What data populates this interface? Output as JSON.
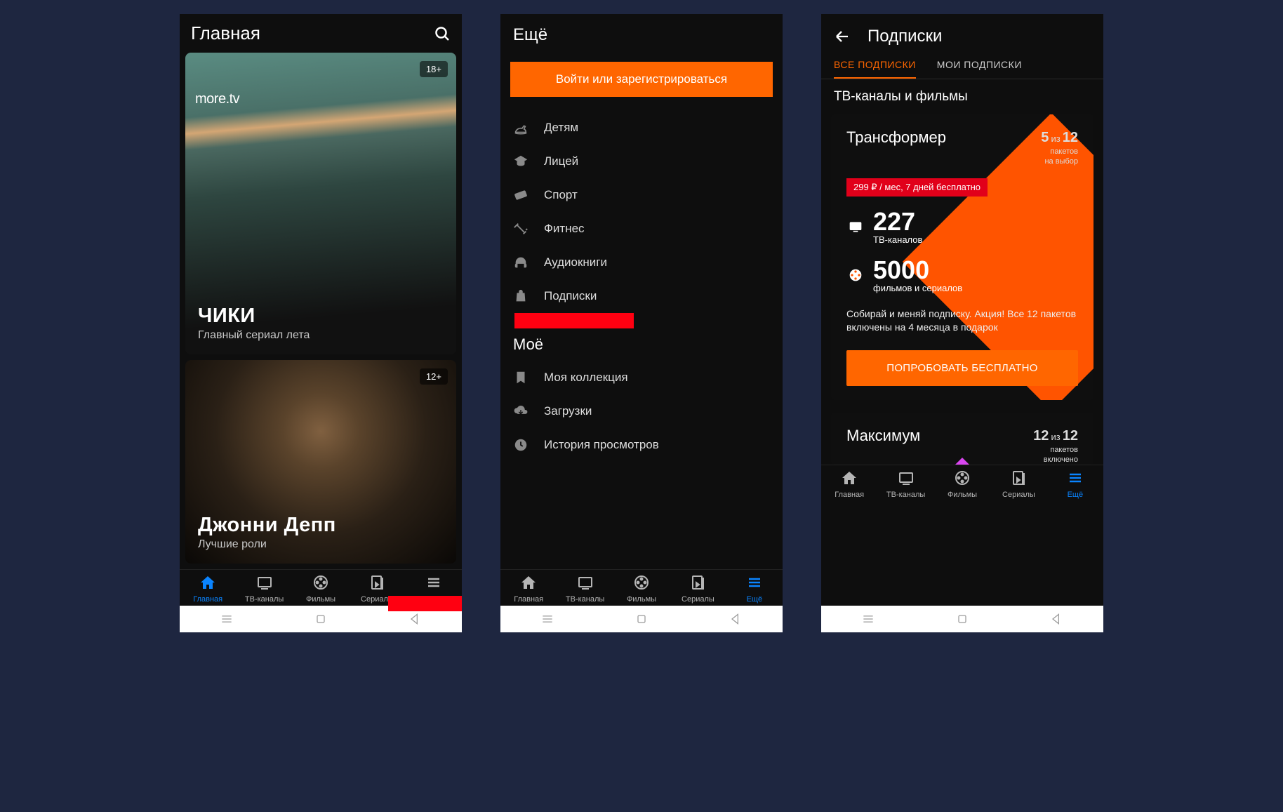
{
  "nav": {
    "items": [
      {
        "label": "Главная"
      },
      {
        "label": "ТВ-каналы"
      },
      {
        "label": "Фильмы"
      },
      {
        "label": "Сериалы"
      },
      {
        "label": "Ещё"
      }
    ]
  },
  "screen1": {
    "title": "Главная",
    "hero1": {
      "logo": "more.tv",
      "age": "18+",
      "title": "ЧИКИ",
      "sub": "Главный сериал лета"
    },
    "hero2": {
      "age": "12+",
      "title": "Джонни Депп",
      "sub": "Лучшие роли"
    },
    "activeNavIndex": 0
  },
  "screen2": {
    "title": "Ещё",
    "login": "Войти или зарегистрироваться",
    "cats": [
      {
        "label": "Детям"
      },
      {
        "label": "Лицей"
      },
      {
        "label": "Спорт"
      },
      {
        "label": "Фитнес"
      },
      {
        "label": "Аудиокниги"
      },
      {
        "label": "Подписки"
      }
    ],
    "mine_title": "Моё",
    "mine": [
      {
        "label": "Моя коллекция"
      },
      {
        "label": "Загрузки"
      },
      {
        "label": "История просмотров"
      }
    ],
    "activeNavIndex": 4
  },
  "screen3": {
    "title": "Подписки",
    "tabs": [
      {
        "label": "ВСЕ ПОДПИСКИ",
        "active": true
      },
      {
        "label": "МОИ ПОДПИСКИ",
        "active": false
      }
    ],
    "section": "ТВ-каналы и фильмы",
    "card1": {
      "title": "Трансформер",
      "count_a": "5",
      "count_iz": "из",
      "count_b": "12",
      "count_sub": "пакетов\nна выбор",
      "price": "299 ₽ / мес, 7 дней бесплатно",
      "stat1_num": "227",
      "stat1_lbl": "ТВ-каналов",
      "stat2_num": "5000",
      "stat2_lbl": "фильмов и сериалов",
      "desc": "Собирай и меняй подписку. Акция! Все 12 пакетов включены на 4 месяца в подарок",
      "cta": "ПОПРОБОВАТЬ БЕСПЛАТНО"
    },
    "card2": {
      "title": "Максимум",
      "count_a": "12",
      "count_iz": "из",
      "count_b": "12",
      "count_sub": "пакетов\nвключено"
    },
    "activeNavIndex": 4
  }
}
